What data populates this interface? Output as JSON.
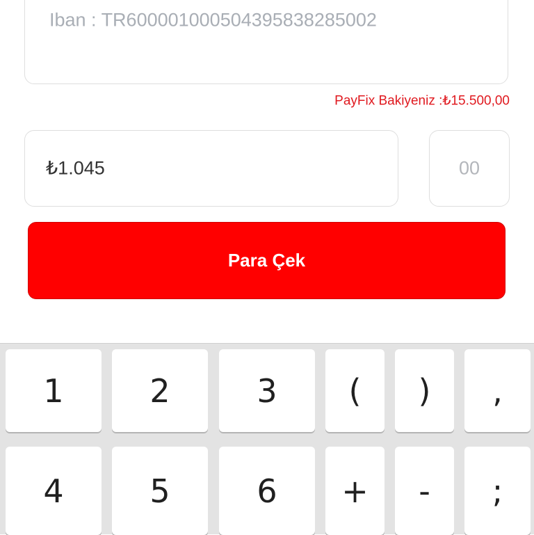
{
  "form": {
    "iban_text": "Iban : TR600001000504395838285002",
    "balance_text": "PayFix Bakiyeniz :₺15.500,00",
    "amount_value": "₺1.045",
    "cents_placeholder": "00",
    "submit_label": "Para Çek"
  },
  "keyboard": {
    "row1": [
      "1",
      "2",
      "3",
      "(",
      ")",
      ","
    ],
    "row2": [
      "4",
      "5",
      "6",
      "+",
      "-",
      ";"
    ]
  },
  "colors": {
    "accent": "#ff0000",
    "balance_text": "#e0191f",
    "placeholder": "#a9aeb5",
    "keyboard_bg": "#e3e3e3"
  }
}
